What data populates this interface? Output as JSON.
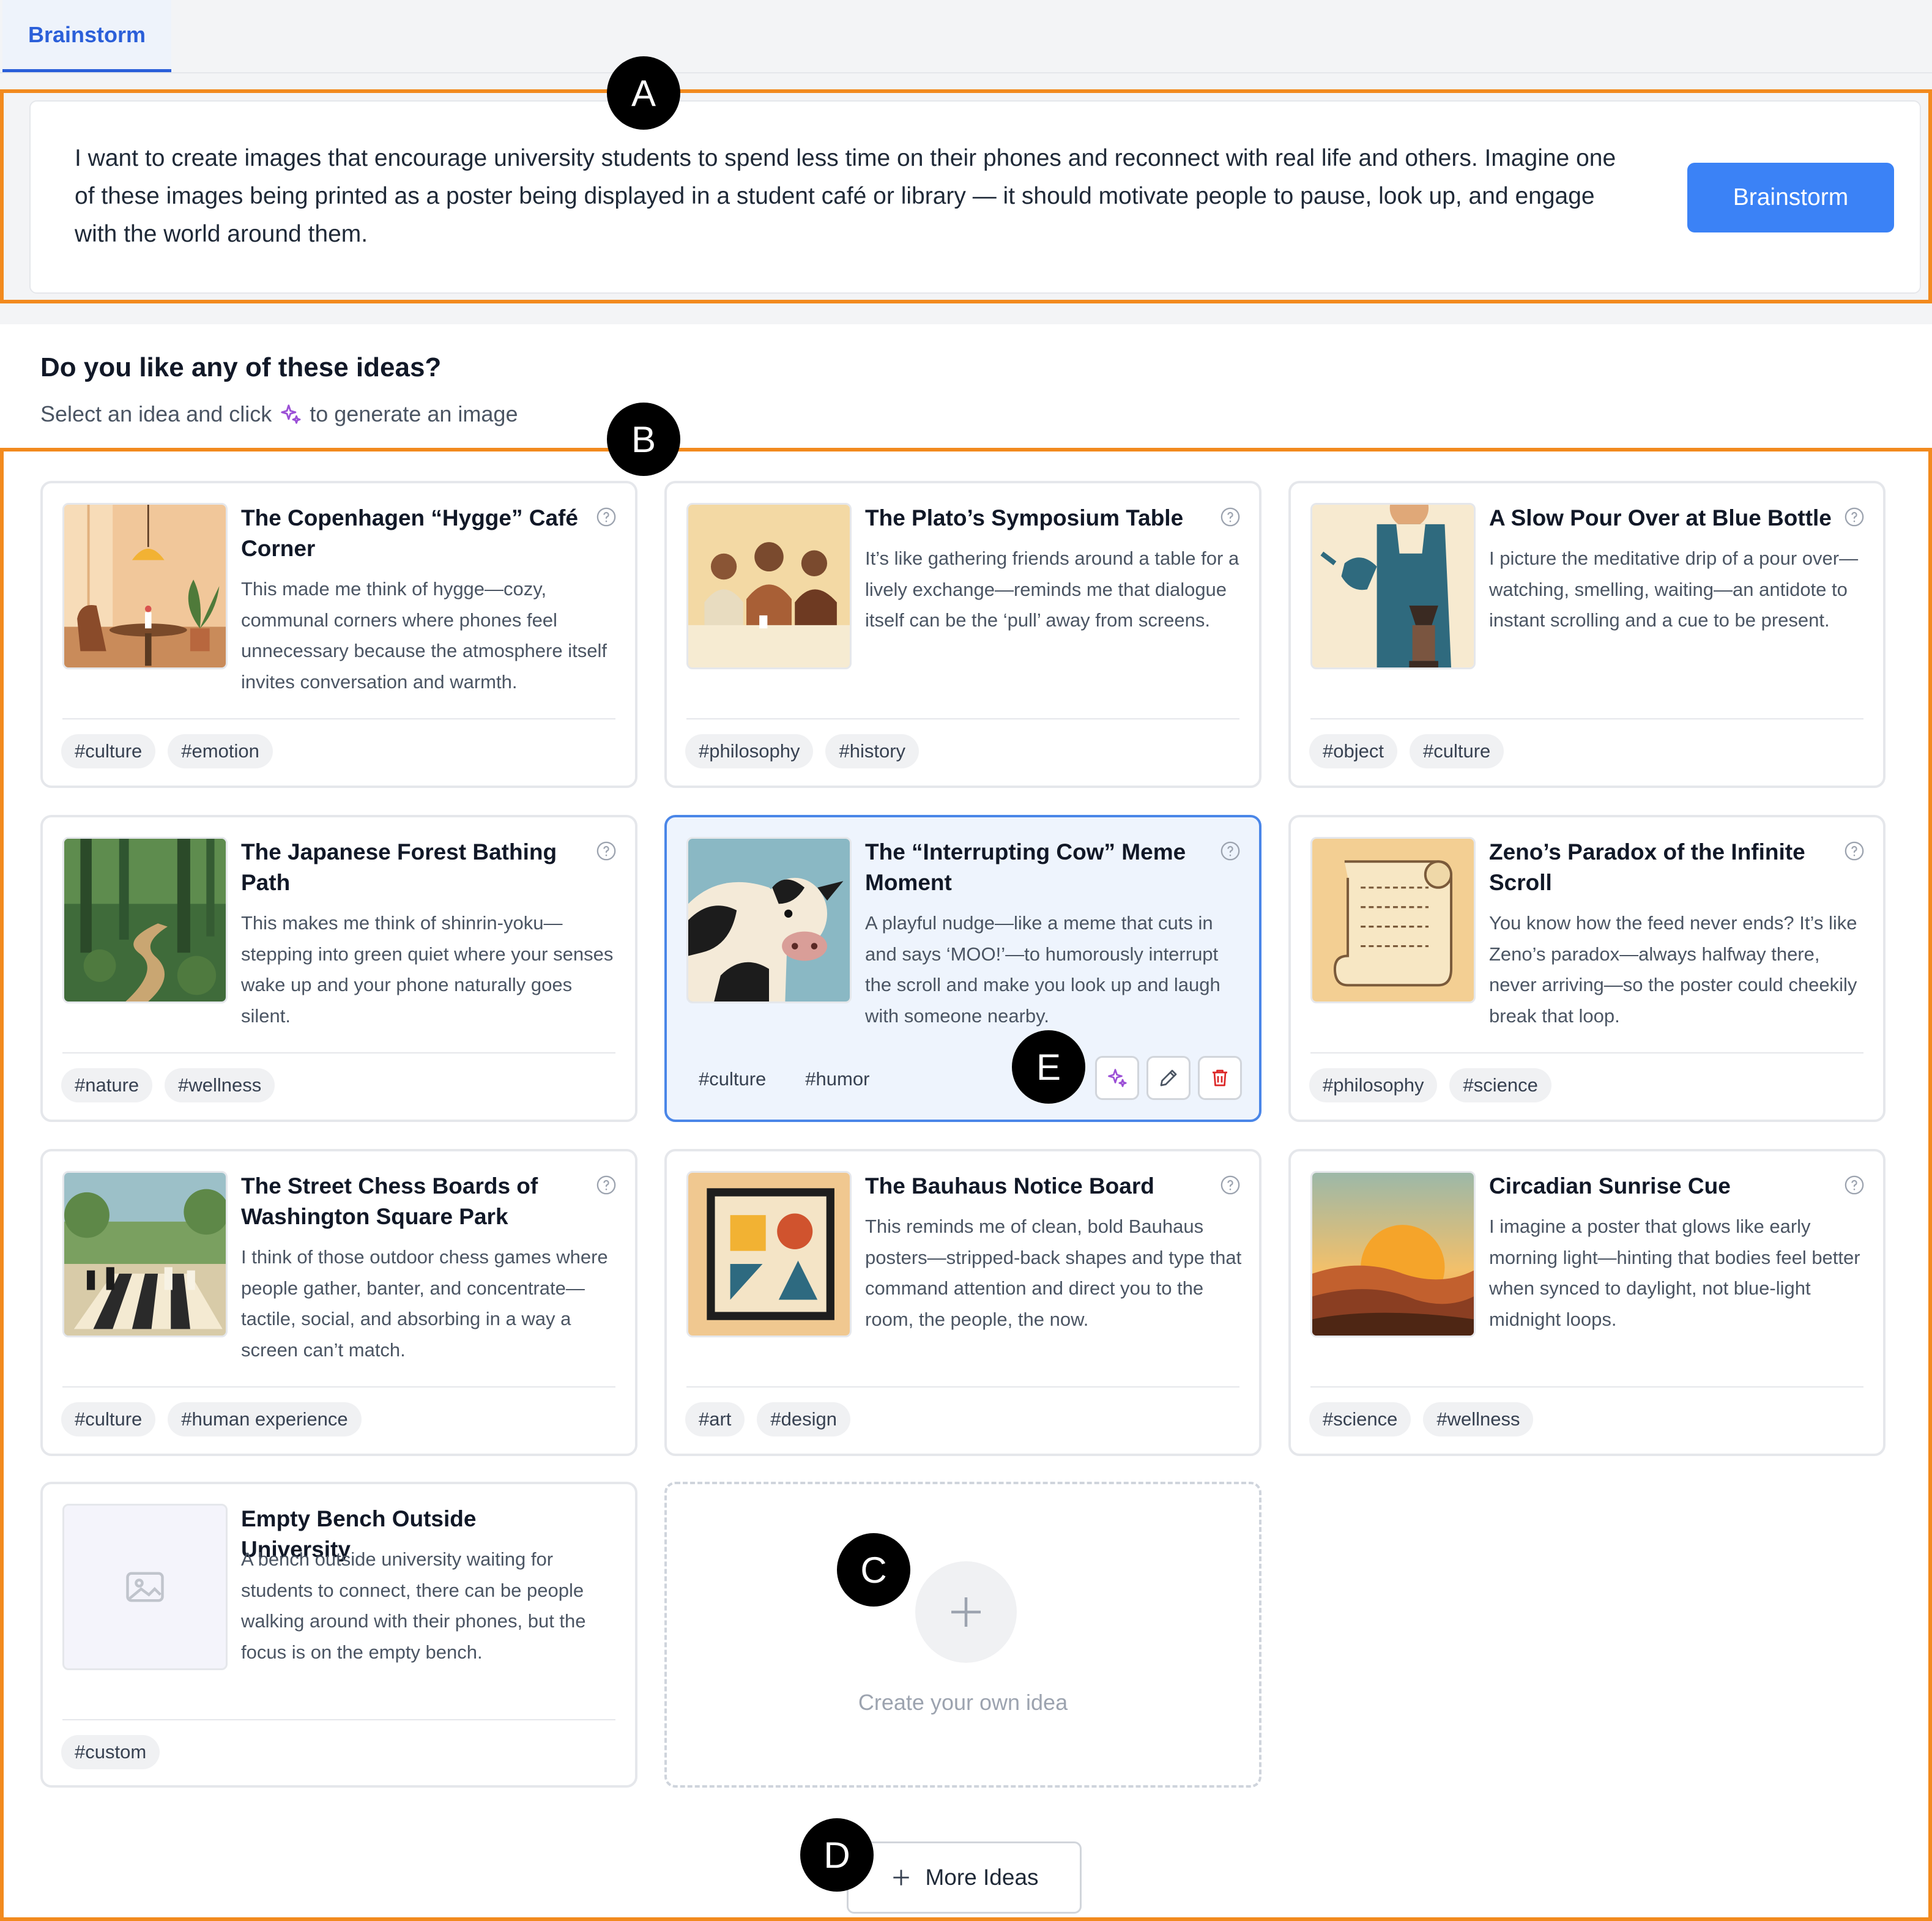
{
  "tabs": [
    {
      "label": "Brainstorm"
    }
  ],
  "prompt": {
    "text": "I want to create images that encourage university students to spend less time on their phones and reconnect with real life and others. Imagine one of these images being printed as a poster being displayed in a student café or library — it should motivate people to pause, look up, and engage with the world around them.",
    "button_label": "Brainstorm"
  },
  "ideas_section": {
    "heading": "Do you like any of these ideas?",
    "sub_before": "Select an idea and click",
    "sub_after": "to generate an image"
  },
  "ideas": [
    {
      "title": "The Copenhagen “Hygge” Café Corner",
      "desc": "This made me think of hygge—cozy, communal corners where phones feel unnecessary because the atmosphere itself invites conversation and warmth.",
      "tags": [
        "#culture",
        "#emotion"
      ]
    },
    {
      "title": "The Plato’s Symposium Table",
      "desc": "It’s like gathering friends around a table for a lively exchange—reminds me that dialogue itself can be the ‘pull’ away from screens.",
      "tags": [
        "#philosophy",
        "#history"
      ]
    },
    {
      "title": "A Slow Pour Over at Blue Bottle",
      "desc": "I picture the meditative drip of a pour over—watching, smelling, waiting—an antidote to instant scrolling and a cue to be present.",
      "tags": [
        "#object",
        "#culture"
      ]
    },
    {
      "title": "The Japanese Forest Bathing Path",
      "desc": "This makes me think of shinrin-yoku—stepping into green quiet where your senses wake up and your phone naturally goes silent.",
      "tags": [
        "#nature",
        "#wellness"
      ]
    },
    {
      "title": "The “Interrupting Cow” Meme Moment",
      "desc": "A playful nudge—like a meme that cuts in and says ‘MOO!’—to humorously interrupt the scroll and make you look up and laugh with someone nearby.",
      "tags": [
        "#culture",
        "#humor"
      ]
    },
    {
      "title": "Zeno’s Paradox of the Infinite Scroll",
      "desc": "You know how the feed never ends? It’s like Zeno’s paradox—always halfway there, never arriving—so the poster could cheekily break that loop.",
      "tags": [
        "#philosophy",
        "#science"
      ]
    },
    {
      "title": "The Street Chess Boards of Washington Square Park",
      "desc": "I think of those outdoor chess games where people gather, banter, and concentrate—tactile, social, and absorbing in a way a screen can’t match.",
      "tags": [
        "#culture",
        "#human experience"
      ]
    },
    {
      "title": "The Bauhaus Notice Board",
      "desc": "This reminds me of clean, bold Bauhaus posters—stripped-back shapes and type that command attention and direct you to the room, the people, the now.",
      "tags": [
        "#art",
        "#design"
      ]
    },
    {
      "title": "Circadian Sunrise Cue",
      "desc": "I imagine a poster that glows like early morning light—hinting that bodies feel better when synced to daylight, not blue-light midnight loops.",
      "tags": [
        "#science",
        "#wellness"
      ]
    },
    {
      "title": "Empty Bench Outside University",
      "desc": "A bench outside university waiting for students to connect, there can be people walking around with their phones, but the focus is on the empty bench.",
      "tags": [
        "#custom"
      ]
    }
  ],
  "create_card": {
    "label": "Create your own idea"
  },
  "more_button": {
    "label": "More Ideas"
  },
  "annotations": {
    "a": "A",
    "b": "B",
    "c": "C",
    "d": "D",
    "e": "E"
  },
  "colors": {
    "accent": "#3b82f6",
    "tab_active": "#2b5fd9",
    "annotation": "#f28a1e",
    "selected_border": "#4a86e8",
    "sparkle": "#9b4fd6",
    "delete": "#dc2626"
  }
}
